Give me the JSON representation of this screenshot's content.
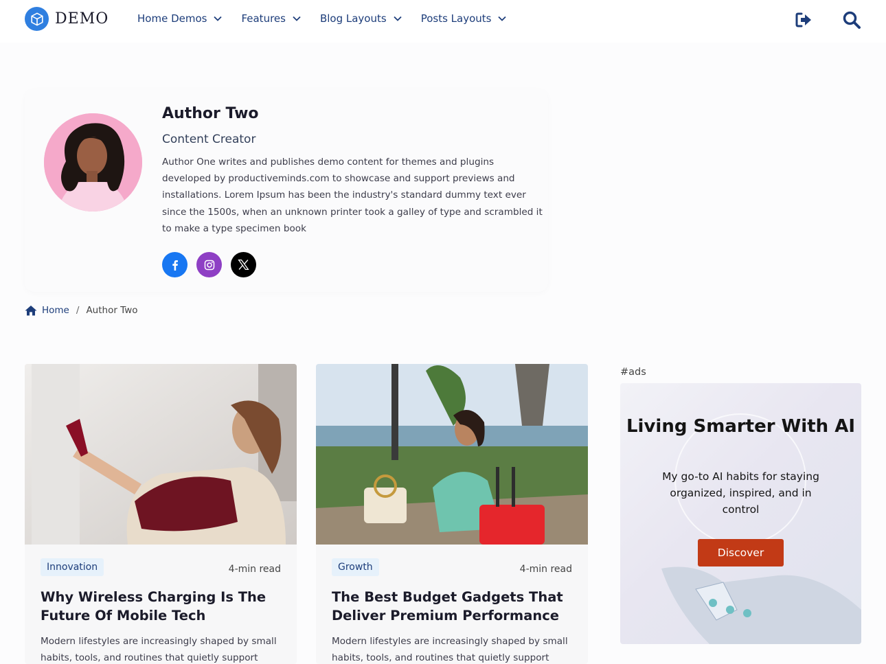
{
  "brand": {
    "name": "DEMO",
    "logo_icon": "cube-icon"
  },
  "nav": [
    {
      "label": "Home Demos"
    },
    {
      "label": "Features"
    },
    {
      "label": "Blog Layouts"
    },
    {
      "label": "Posts Layouts"
    }
  ],
  "header_actions": {
    "login_icon": "sign-in-icon",
    "search_icon": "search-icon"
  },
  "author": {
    "name": "Author Two",
    "role": "Content Creator",
    "bio": "Author One writes and publishes demo content for themes and plugins developed by productiveminds.com to showcase and support previews and installations. Lorem Ipsum has been the industry's standard dummy text ever since the 1500s, when an unknown printer took a galley of type and scrambled it to make a type specimen book",
    "social": [
      {
        "name": "facebook",
        "icon": "facebook-icon",
        "color": "#1877f2"
      },
      {
        "name": "instagram",
        "icon": "instagram-icon",
        "color": "#8e3fc4"
      },
      {
        "name": "x",
        "icon": "x-icon",
        "color": "#000000"
      }
    ]
  },
  "breadcrumb": {
    "home": "Home",
    "separator": "/",
    "current": "Author Two"
  },
  "posts": [
    {
      "tag": "Innovation",
      "read_time": "4-min read",
      "title": "Why Wireless Charging Is The Future Of Mobile Tech",
      "excerpt": "Modern lifestyles are increasingly shaped by small habits, tools, and routines that quietly support"
    },
    {
      "tag": "Growth",
      "read_time": "4-min read",
      "title": "The Best Budget Gadgets That Deliver Premium Performance",
      "excerpt": "Modern lifestyles are increasingly shaped by small habits, tools, and routines that quietly support"
    }
  ],
  "ad": {
    "label": "#ads",
    "title": "Living Smarter With AI",
    "subtitle": "My go-to AI habits for staying organized, inspired, and in control",
    "button": "Discover",
    "button_color": "#c23a16"
  },
  "colors": {
    "accent": "#1d3d7a",
    "logo": "#2f7fe0",
    "tag_bg": "#e6f1fb"
  }
}
